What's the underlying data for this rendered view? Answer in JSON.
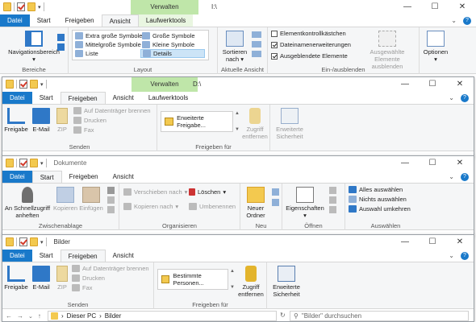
{
  "w1": {
    "context_tab": "Verwalten",
    "path": "I:\\",
    "tabs": [
      "Datei",
      "Start",
      "Freigeben",
      "Ansicht",
      "Laufwerktools"
    ],
    "nav_pane": "Navigationsbereich",
    "nav_pane_arrow": "▾",
    "groups": {
      "panes": "Bereiche",
      "layout": "Layout",
      "current_view": "Aktuelle Ansicht",
      "show_hide": "Ein-/ausblenden"
    },
    "layout_options": [
      "Extra große Symbole",
      "Große Symbole",
      "Mittelgroße Symbole",
      "Kleine Symbole",
      "Liste",
      "Details"
    ],
    "sort": [
      "Sortieren",
      "nach"
    ],
    "sort_arrow": "▾",
    "checkboxes": [
      {
        "label": "Elementkontrollkästchen",
        "checked": false
      },
      {
        "label": "Dateinamenerweiterungen",
        "checked": true
      },
      {
        "label": "Ausgeblendete Elemente",
        "checked": true
      }
    ],
    "hide_selected": [
      "Ausgewählte",
      "Elemente ausblenden"
    ],
    "options": "Optionen",
    "options_arrow": "▾"
  },
  "w2": {
    "context_tab": "Verwalten",
    "path": "D:\\",
    "tabs": [
      "Datei",
      "Start",
      "Freigeben",
      "Ansicht",
      "Laufwerktools"
    ],
    "send": {
      "share": "Freigabe",
      "email": "E-Mail",
      "zip": "ZIP",
      "burn": "Auf Datenträger brennen",
      "print": "Drucken",
      "fax": "Fax",
      "label": "Senden"
    },
    "share_with": {
      "item": "Erweiterte Freigabe...",
      "label": "Freigeben für"
    },
    "stop_sharing": [
      "Zugriff",
      "entfernen"
    ],
    "adv_security": [
      "Erweiterte",
      "Sicherheit"
    ]
  },
  "w3": {
    "path": "Dokumente",
    "tabs": [
      "Datei",
      "Start",
      "Freigeben",
      "Ansicht"
    ],
    "clipboard": {
      "pin": [
        "An Schnellzugriff",
        "anheften"
      ],
      "copy": "Kopieren",
      "paste": "Einfügen",
      "label": "Zwischenablage"
    },
    "organize": {
      "move": "Verschieben nach",
      "copyto": "Kopieren nach",
      "delete": "Löschen",
      "rename": "Umbenennen",
      "label": "Organisieren"
    },
    "new": {
      "folder": [
        "Neuer",
        "Ordner"
      ],
      "label": "Neu"
    },
    "open": {
      "props": "Eigenschaften",
      "label": "Öffnen"
    },
    "select": {
      "all": "Alles auswählen",
      "none": "Nichts auswählen",
      "invert": "Auswahl umkehren",
      "label": "Auswählen"
    }
  },
  "w4": {
    "path": "Bilder",
    "tabs": [
      "Datei",
      "Start",
      "Freigeben",
      "Ansicht"
    ],
    "send": {
      "share": "Freigabe",
      "email": "E-Mail",
      "zip": "ZIP",
      "burn": "Auf Datenträger brennen",
      "print": "Drucken",
      "fax": "Fax",
      "label": "Senden"
    },
    "share_with": {
      "item": "Bestimmte Personen...",
      "label": "Freigeben für"
    },
    "stop_sharing": [
      "Zugriff",
      "entfernen"
    ],
    "adv_security": [
      "Erweiterte",
      "Sicherheit"
    ],
    "address": [
      "Dieser PC",
      "Bilder"
    ],
    "search_placeholder": "\"Bilder\" durchsuchen"
  },
  "controls": {
    "min": "—",
    "max": "☐",
    "close": "✕",
    "collapse": "⌃",
    "dropdown": "▾",
    "breadcrumb_sep": "›",
    "back": "←",
    "forward": "→",
    "up": "↑",
    "refresh": "↻",
    "search": "⚲",
    "arrow_down": "⌄"
  },
  "colors": {
    "file_tab": "#1979ca",
    "context_tab": "#bfe6a9",
    "ribbon_bg": "#f5f6f7",
    "selected": "#cce4f7"
  }
}
